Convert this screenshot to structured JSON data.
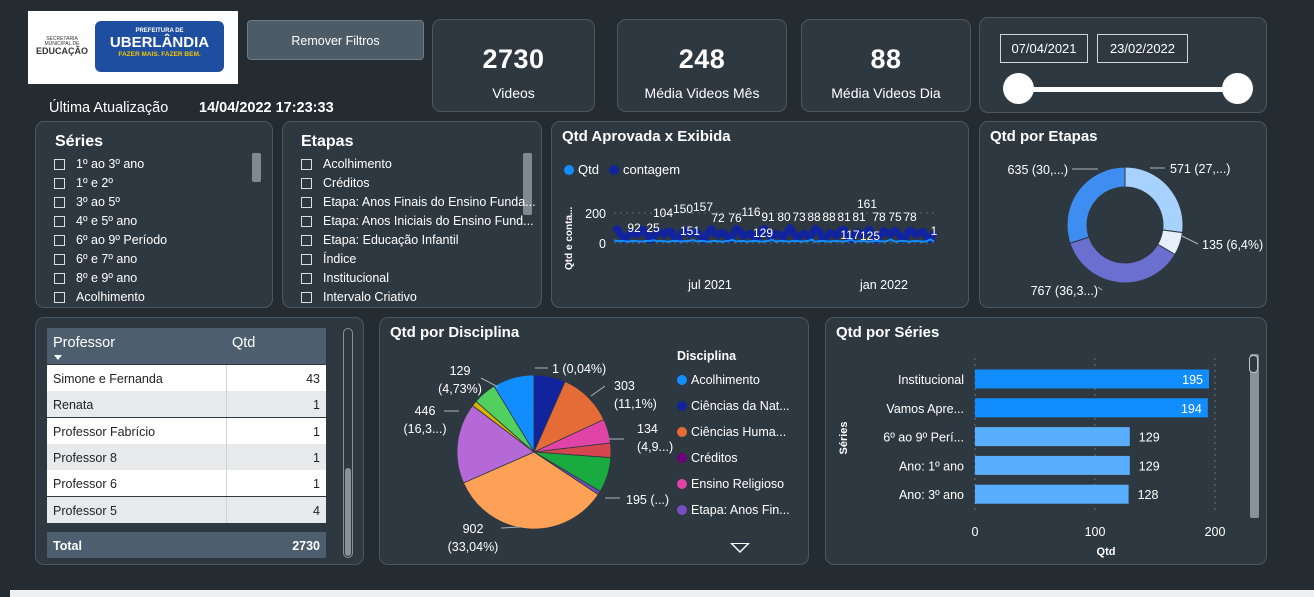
{
  "logo": {
    "org_line1": "SECRETARIA",
    "org_line2": "MUNICIPAL DE",
    "org_line3": "EDUCAÇÃO",
    "badge_top": "PREFEITURA DE",
    "badge_main": "UBERLÂNDIA",
    "badge_slogan": "FAZER MAIS. FAZER BEM."
  },
  "remove_filters_label": "Remover Filtros",
  "last_update": {
    "label": "Última Atualização",
    "value": "14/04/2022 17:23:33"
  },
  "kpis": [
    {
      "value": "2730",
      "label": "Videos"
    },
    {
      "value": "248",
      "label": "Média Videos Mês"
    },
    {
      "value": "88",
      "label": "Média Videos Dia"
    }
  ],
  "date_range": {
    "start": "07/04/2021",
    "end": "23/02/2022"
  },
  "series_slicer": {
    "title": "Séries",
    "items": [
      "1º ao 3º ano",
      "1º e 2º",
      "3º ao 5º",
      "4º e 5º ano",
      "6º ao 9º Período",
      "6º e 7º ano",
      "8º e 9º ano",
      "Acolhimento"
    ]
  },
  "etapas_slicer": {
    "title": "Etapas",
    "items": [
      "Acolhimento",
      "Créditos",
      "Etapa: Anos Finais do Ensino Funda...",
      "Etapa: Anos Iniciais do Ensino Fund...",
      "Etapa: Educação Infantil",
      "Índice",
      "Institucional",
      "Intervalo Criativo"
    ]
  },
  "professor_table": {
    "headers": [
      "Professor",
      "Qtd"
    ],
    "rows": [
      {
        "name": "Simone e Fernanda",
        "qtd": "43"
      },
      {
        "name": "Renata",
        "qtd": "1"
      },
      {
        "name": "Professor Fabrício",
        "qtd": "1"
      },
      {
        "name": "Professor 8",
        "qtd": "1"
      },
      {
        "name": "Professor 6",
        "qtd": "1"
      },
      {
        "name": "Professor 5",
        "qtd": "4"
      }
    ],
    "total_label": "Total",
    "total_value": "2730"
  },
  "colors": {
    "qtd": "#118dff",
    "contagem": "#12239e",
    "etapas": [
      "#a7d1ff",
      "#e6f0fb",
      "#6b6fcf",
      "#3d8ef0"
    ],
    "disciplina": [
      "#118dff",
      "#12239e",
      "#e66c37",
      "#6b007b",
      "#e044a7",
      "#744ec2",
      "#1aab40",
      "#fda156",
      "#b469d6",
      "#51d060",
      "#d9b300",
      "#d64550"
    ],
    "bar": "#118dff"
  },
  "chart_data": [
    {
      "type": "line",
      "title": "Qtd Aprovada x Exibida",
      "ylabel": "Qtd e conta...",
      "x_ticks": [
        "jul 2021",
        "jan 2022"
      ],
      "y_ticks": [
        "200",
        "0"
      ],
      "ylim": [
        0,
        260
      ],
      "legend_position": "top-left",
      "series": [
        {
          "name": "Qtd",
          "point_labels": [
            "92",
            "25",
            "151",
            "129",
            "117",
            "125",
            "1"
          ]
        },
        {
          "name": "contagem",
          "point_labels": [
            "104",
            "150",
            "157",
            "72",
            "76",
            "116",
            "91",
            "80",
            "73",
            "88",
            "88",
            "81",
            "81",
            "161",
            "78",
            "75",
            "78"
          ]
        }
      ]
    },
    {
      "type": "pie",
      "title": "Qtd por Etapas",
      "donut": true,
      "slice_labels": [
        "571 (27,...)",
        "135 (6,4%)",
        "767 (36,3...)",
        "635 (30,...)"
      ],
      "values": [
        571,
        135,
        767,
        635
      ]
    },
    {
      "type": "pie",
      "title": "Qtd por Disciplina",
      "legend_title": "Disciplina",
      "legend_position": "right",
      "legend": [
        "Acolhimento",
        "Ciências da Nat...",
        "Ciências Huma...",
        "Créditos",
        "Ensino Religioso",
        "Etapa: Anos Fin..."
      ],
      "slice_labels": [
        "1 (0,04%)",
        "303 (11,1%)",
        "134 (4,9...)",
        "195 (...)",
        "902 (33,04%)",
        "446 (16,3...)",
        "129 (4,73%)"
      ],
      "values": [
        1,
        303,
        134,
        195,
        902,
        446,
        129
      ]
    },
    {
      "type": "bar",
      "orientation": "horizontal",
      "title": "Qtd por Séries",
      "categories": [
        "Institucional",
        "Vamos Apre...",
        "6º ao 9º Perí...",
        "Ano: 1º ano",
        "Ano: 3º ano"
      ],
      "values": [
        195,
        194,
        129,
        129,
        128
      ],
      "xlabel": "Qtd",
      "ylabel": "Séries",
      "x_ticks": [
        "0",
        "100",
        "200"
      ],
      "xlim": [
        0,
        200
      ]
    }
  ]
}
